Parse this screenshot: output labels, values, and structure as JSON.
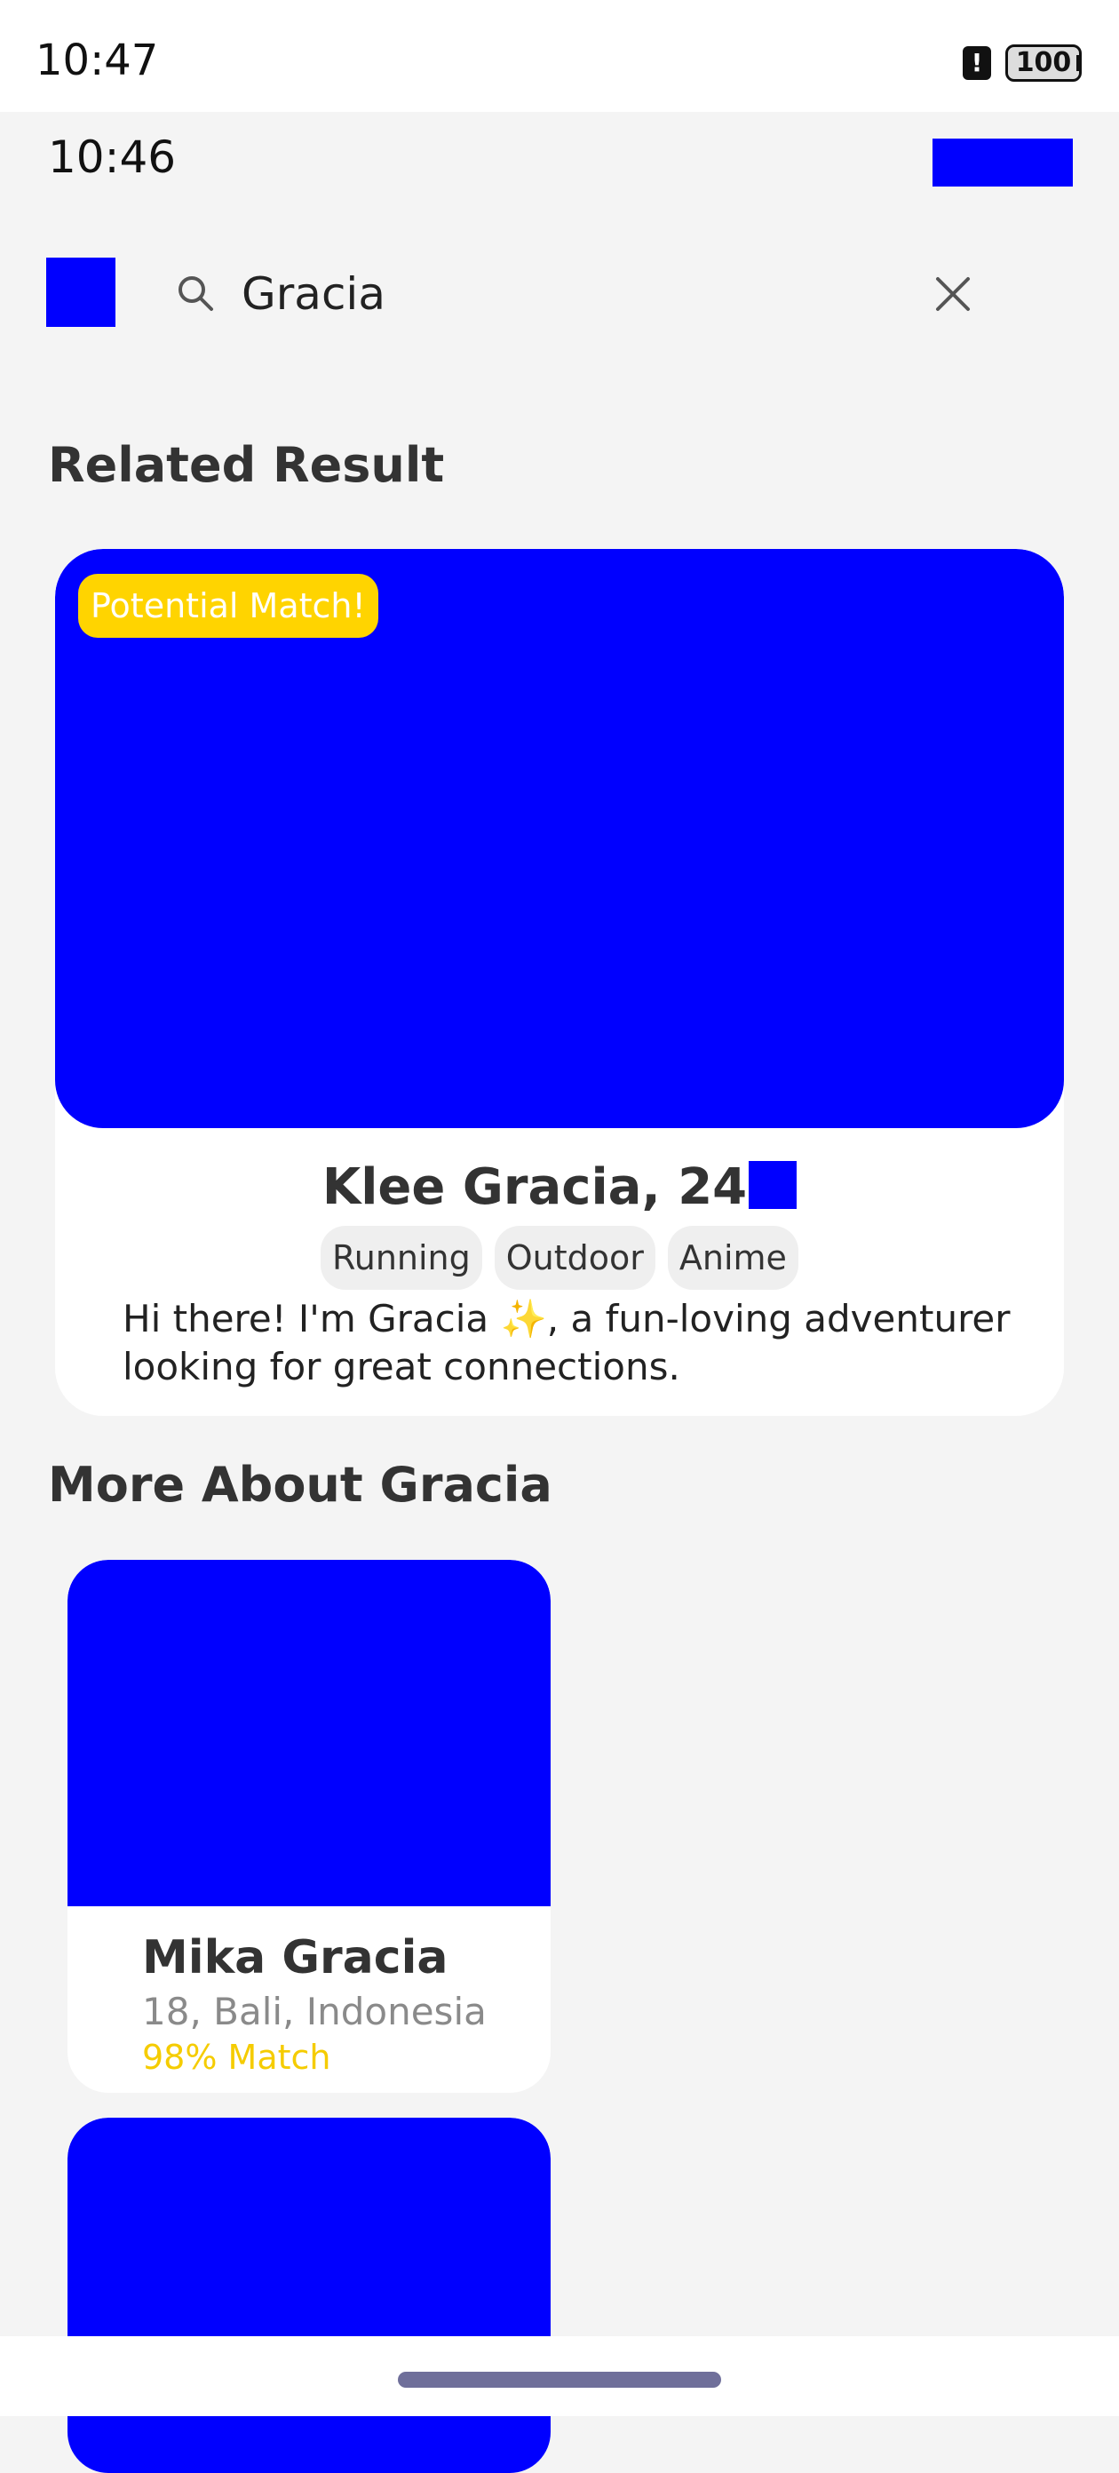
{
  "status_bar": {
    "time": "10:47",
    "alert_icon": "!",
    "battery": "100"
  },
  "app_time": "10:46",
  "search": {
    "value": "Gracia",
    "placeholder": ""
  },
  "sections": {
    "related": "Related Result",
    "more": "More About Gracia"
  },
  "featured": {
    "badge": "Potential Match!",
    "name": "Klee Gracia, 24",
    "tags": [
      "Running",
      "Outdoor",
      "Anime"
    ],
    "bio": "Hi there! I'm Gracia ✨, a fun-loving adventurer looking for great connections."
  },
  "more_results": [
    {
      "name": "Mika Gracia",
      "location": "18, Bali, Indonesia",
      "match": "98% Match"
    }
  ],
  "colors": {
    "accent": "#0000ff",
    "highlight": "#ffd400",
    "background": "#f4f4f4"
  }
}
